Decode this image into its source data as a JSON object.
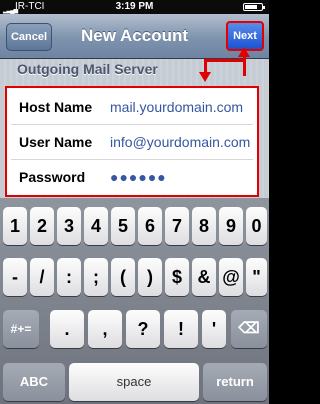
{
  "status_bar": {
    "carrier": "IR-TCI",
    "time": "3:19 PM"
  },
  "nav": {
    "title": "New Account",
    "cancel_label": "Cancel",
    "next_label": "Next"
  },
  "section": {
    "header": "Outgoing Mail Server"
  },
  "form": {
    "host_label": "Host Name",
    "host_value": "mail.yourdomain.com",
    "user_label": "User Name",
    "user_value": "info@yourdomain.com",
    "password_label": "Password",
    "password_value": "●●●●●●"
  },
  "keyboard": {
    "row1": [
      "1",
      "2",
      "3",
      "4",
      "5",
      "6",
      "7",
      "8",
      "9",
      "0"
    ],
    "row2": [
      "-",
      "/",
      ":",
      ";",
      "(",
      ")",
      "$",
      "&",
      "@",
      "\""
    ],
    "row3_left": "#+=",
    "row3": [
      ".",
      ",",
      "?",
      "!",
      "'"
    ],
    "abc": "ABC",
    "space": "space",
    "return": "return"
  },
  "colors": {
    "highlight_red": "#e00000",
    "next_blue": "#1a53d2",
    "value_blue": "#3556a0"
  }
}
